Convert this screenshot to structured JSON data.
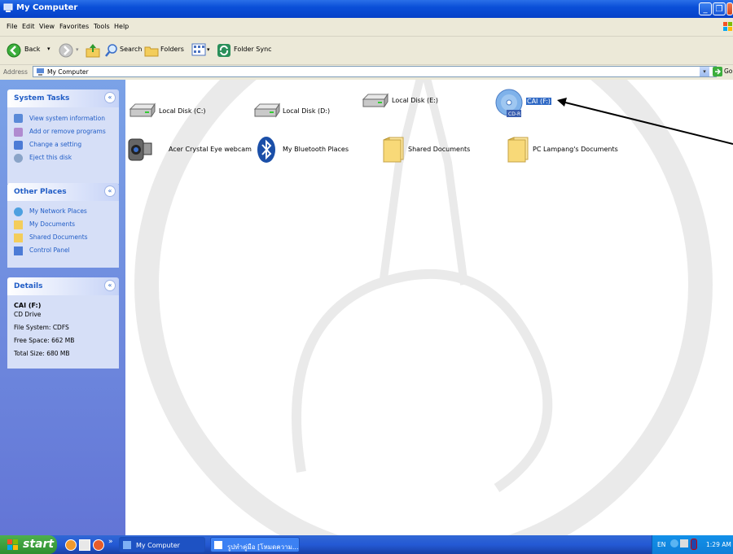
{
  "window": {
    "title": "My Computer"
  },
  "menu": [
    "File",
    "Edit",
    "View",
    "Favorites",
    "Tools",
    "Help"
  ],
  "toolbar": {
    "back": "Back",
    "search": "Search",
    "folders": "Folders",
    "folder_sync": "Folder Sync"
  },
  "address": {
    "label": "Address",
    "value": "My Computer",
    "go": "Go"
  },
  "system_tasks": {
    "title": "System Tasks",
    "items": [
      "View system information",
      "Add or remove programs",
      "Change a setting",
      "Eject this disk"
    ]
  },
  "other_places": {
    "title": "Other Places",
    "items": [
      "My Network Places",
      "My Documents",
      "Shared Documents",
      "Control Panel"
    ]
  },
  "details": {
    "title": "Details",
    "name": "CAI (F:)",
    "type": "CD Drive",
    "fs": "File System: CDFS",
    "free": "Free Space: 662 MB",
    "total": "Total Size: 680 MB"
  },
  "items": [
    {
      "label": "Local Disk (C:)",
      "icon": "hard-drive-icon"
    },
    {
      "label": "Local Disk (D:)",
      "icon": "hard-drive-icon"
    },
    {
      "label": "Local Disk (E:)",
      "icon": "hard-drive-icon"
    },
    {
      "label": "CAI (F:)",
      "icon": "cd-drive-icon",
      "badge": "CD-R"
    },
    {
      "label": "Acer Crystal Eye webcam",
      "icon": "webcam-icon"
    },
    {
      "label": "My Bluetooth Places",
      "icon": "bluetooth-icon"
    },
    {
      "label": "Shared Documents",
      "icon": "folder-icon"
    },
    {
      "label": "PC Lampang's Documents",
      "icon": "folder-icon"
    }
  ],
  "taskbar": {
    "start": "start",
    "tasks": [
      "My Computer",
      "รูปทำคู่มือ [โหมดความ..."
    ],
    "lang": "EN",
    "clock": "1:29 AM"
  }
}
